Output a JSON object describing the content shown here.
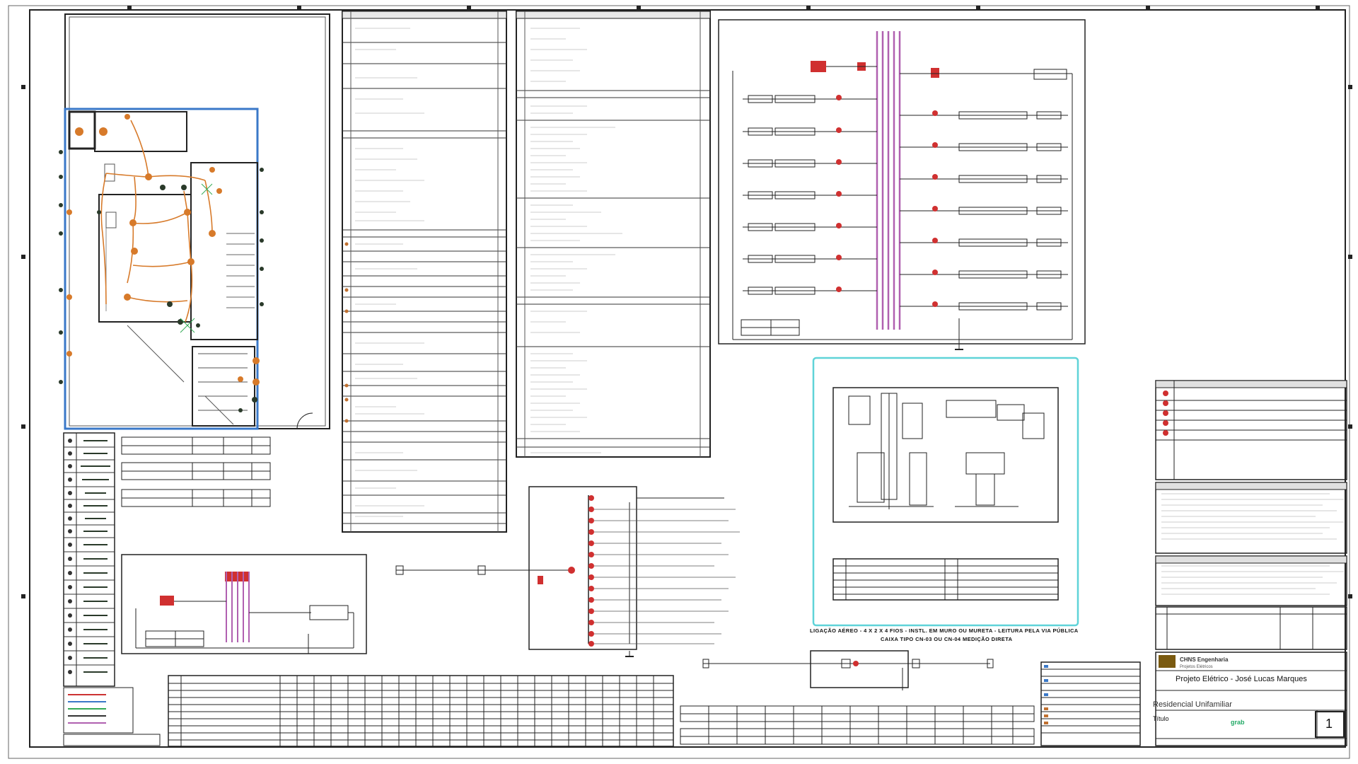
{
  "title_block": {
    "company": "CHNS Engenharia",
    "company_subtitle": "Projetos Elétricos",
    "project_title": "Projeto Elétrico - José Lucas Marques",
    "project_subtitle": "Residencial Unifamiliar",
    "field_label": "Título",
    "logo_text": "grab",
    "sheet_number": "1"
  },
  "entrance_note": {
    "line1": "LIGAÇÃO AÉREO - 4 X 2 X 4 FIOS - INSTL. EM MURO OU MURETA - LEITURA PELA VIA PÚBLICA",
    "line2": "CAIXA TIPO CN-03 OU CN-04 MEDIÇÃO DIRETA"
  },
  "colors": {
    "frame": "#222222",
    "wiring": "#d77a2a",
    "wall_blue": "#3a78c8",
    "device_dark": "#2a3a2a",
    "busbar": "#b060b0",
    "breaker_red": "#d03030",
    "detail_highlight": "#5fd3d8",
    "logo_green": "#2aa65a"
  }
}
